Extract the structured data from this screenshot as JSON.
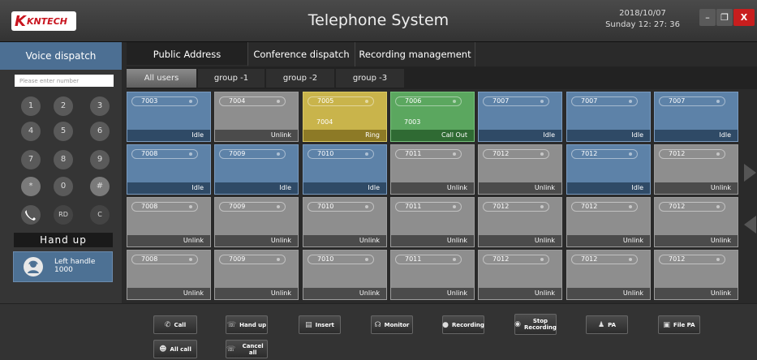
{
  "header": {
    "logo_text": "KNTECH",
    "title": "Telephone System",
    "date": "2018/10/07",
    "time": "Sunday  12: 27: 36",
    "minimize": "–",
    "restore": "❐",
    "close": "X"
  },
  "left_panel": {
    "voice_tab": "Voice dispatch",
    "search_placeholder": "Please enter number",
    "keys": [
      "1",
      "2",
      "3",
      "4",
      "5",
      "6",
      "7",
      "8",
      "9",
      "*",
      "0",
      "#",
      "",
      "RD",
      "C"
    ],
    "hangup_label": "Hand up",
    "handle_label": "Left handle",
    "handle_number": "1000"
  },
  "top_tabs": [
    "Public Address",
    "Conference dispatch",
    "Recording management"
  ],
  "group_tabs": [
    "All users",
    "group -1",
    "group -2",
    "group -3"
  ],
  "grid": {
    "rows": [
      [
        {
          "ext": "7003",
          "status": "Idle",
          "state": "idle"
        },
        {
          "ext": "7004",
          "status": "Unlink",
          "state": "unlink"
        },
        {
          "ext": "7005",
          "status": "Ring",
          "state": "ring",
          "peer": "7004"
        },
        {
          "ext": "7006",
          "status": "Call Out",
          "state": "callout",
          "peer": "7003"
        },
        {
          "ext": "7007",
          "status": "Idle",
          "state": "idle"
        },
        {
          "ext": "7007",
          "status": "Idle",
          "state": "idle"
        },
        {
          "ext": "7007",
          "status": "Idle",
          "state": "idle"
        }
      ],
      [
        {
          "ext": "7008",
          "status": "Idle",
          "state": "idle"
        },
        {
          "ext": "7009",
          "status": "Idle",
          "state": "idle"
        },
        {
          "ext": "7010",
          "status": "Idle",
          "state": "idle"
        },
        {
          "ext": "7011",
          "status": "Unlink",
          "state": "unlink"
        },
        {
          "ext": "7012",
          "status": "Unlink",
          "state": "unlink"
        },
        {
          "ext": "7012",
          "status": "Idle",
          "state": "idle"
        },
        {
          "ext": "7012",
          "status": "Unlink",
          "state": "unlink"
        }
      ],
      [
        {
          "ext": "7008",
          "status": "Unlink",
          "state": "unlink"
        },
        {
          "ext": "7009",
          "status": "Unlink",
          "state": "unlink"
        },
        {
          "ext": "7010",
          "status": "Unlink",
          "state": "unlink"
        },
        {
          "ext": "7011",
          "status": "Unlink",
          "state": "unlink"
        },
        {
          "ext": "7012",
          "status": "Unlink",
          "state": "unlink"
        },
        {
          "ext": "7012",
          "status": "Unlink",
          "state": "unlink"
        },
        {
          "ext": "7012",
          "status": "Unlink",
          "state": "unlink"
        }
      ],
      [
        {
          "ext": "7008",
          "status": "Unlink",
          "state": "unlink"
        },
        {
          "ext": "7009",
          "status": "Unlink",
          "state": "unlink"
        },
        {
          "ext": "7010",
          "status": "Unlink",
          "state": "unlink"
        },
        {
          "ext": "7011",
          "status": "Unlink",
          "state": "unlink"
        },
        {
          "ext": "7012",
          "status": "Unlink",
          "state": "unlink"
        },
        {
          "ext": "7012",
          "status": "Unlink",
          "state": "unlink"
        },
        {
          "ext": "7012",
          "status": "Unlink",
          "state": "unlink"
        }
      ]
    ]
  },
  "toolbar": {
    "call": "Call",
    "hand_up": "Hand up",
    "insert": "Insert",
    "monitor": "Monitor",
    "recording": "Recording",
    "stop_recording_1": "Stop",
    "stop_recording_2": "Recording",
    "pa": "PA",
    "file_pa": "File PA",
    "all_call": "All call",
    "cancel_all": "Cancel all"
  },
  "colors": {
    "idle": "#5d82a8",
    "unlink": "#8e8e8e",
    "ring": "#c9b44b",
    "call_out": "#5ba75f",
    "close": "#c81e1e"
  }
}
